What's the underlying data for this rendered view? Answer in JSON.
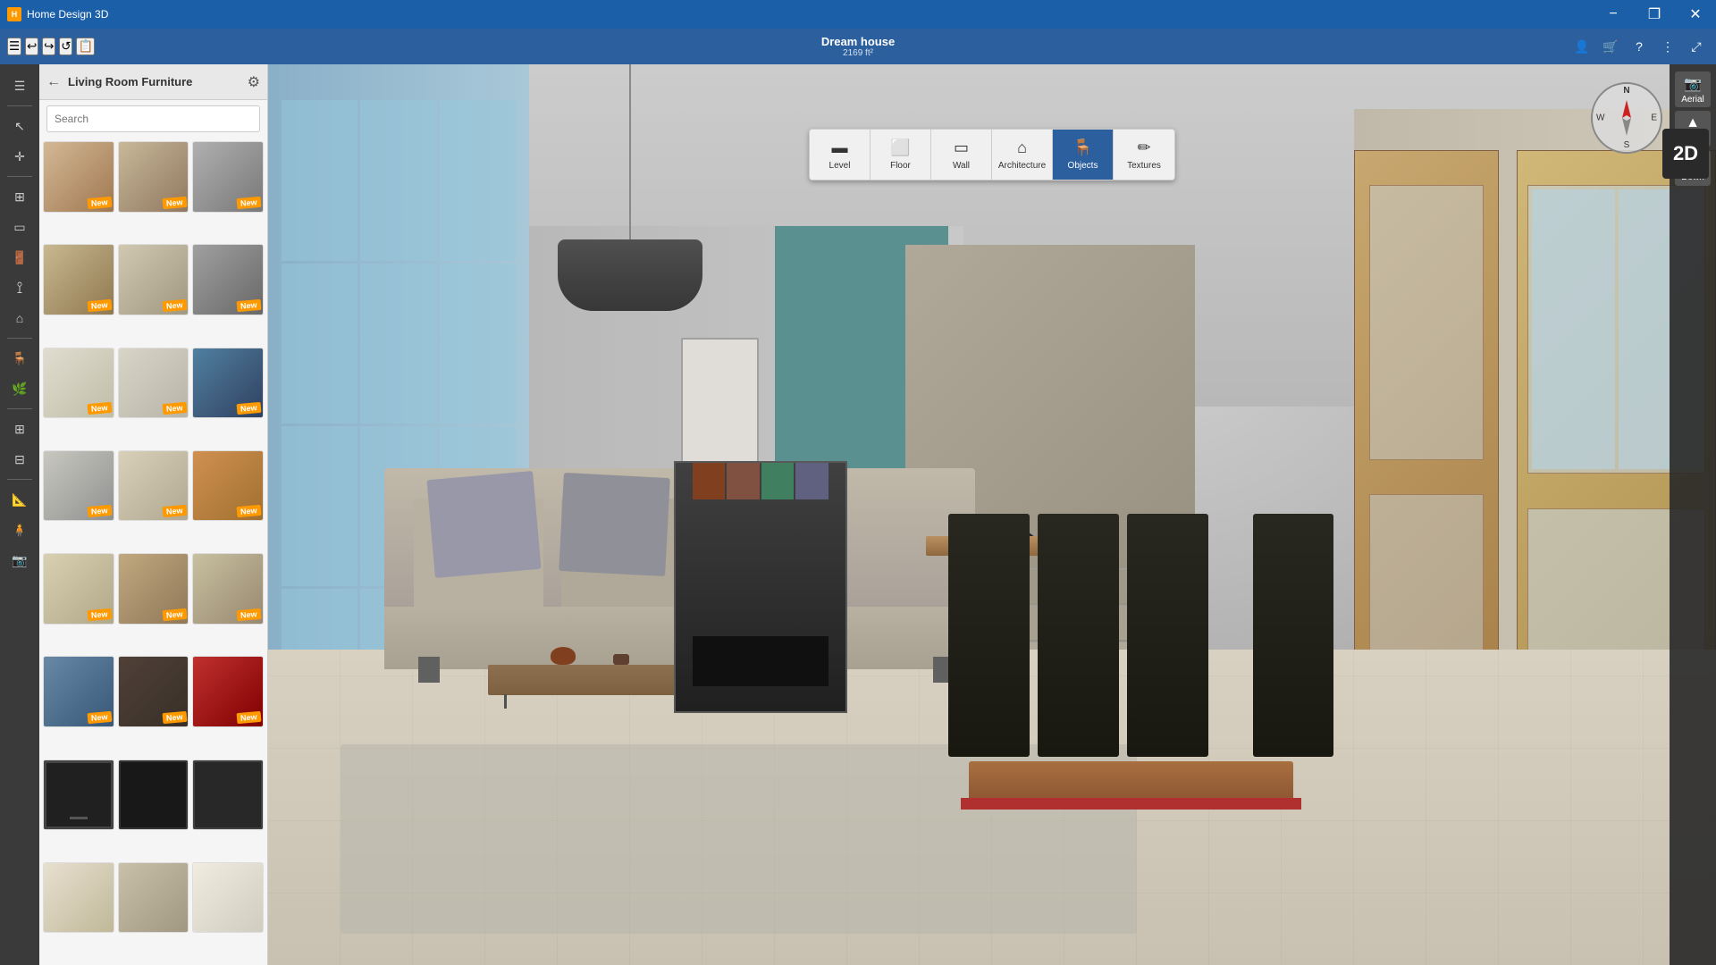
{
  "titlebar": {
    "app_name": "Home Design 3D",
    "minimize": "−",
    "restore": "❐",
    "close": "✕"
  },
  "toolbar": {
    "project_name": "Dream house",
    "project_size": "2169 ft²",
    "undo_label": "Undo",
    "redo_label": "Redo",
    "menu_label": "Menu"
  },
  "view_tabs": [
    {
      "id": "level",
      "label": "Level",
      "icon": "▬"
    },
    {
      "id": "floor",
      "label": "Floor",
      "icon": "⬜"
    },
    {
      "id": "wall",
      "label": "Wall",
      "icon": "▭"
    },
    {
      "id": "architecture",
      "label": "Architecture",
      "icon": "⌂"
    },
    {
      "id": "objects",
      "label": "Objects",
      "icon": "🪑"
    },
    {
      "id": "textures",
      "label": "Textures",
      "icon": "✏"
    }
  ],
  "active_tab": "objects",
  "view_mode": "2D",
  "panel": {
    "title": "Living Room Furniture",
    "search_placeholder": "Search",
    "back_button": "←",
    "settings_icon": "⚙"
  },
  "compass": {
    "n": "N",
    "s": "S",
    "e": "E",
    "w": "W"
  },
  "right_controls": [
    {
      "id": "aerial",
      "label": "Aerial",
      "icon": "📷"
    },
    {
      "id": "up",
      "label": "Up",
      "icon": "▲"
    },
    {
      "id": "down",
      "label": "Down",
      "icon": "▼"
    }
  ],
  "left_tools": [
    {
      "id": "menu",
      "icon": "☰"
    },
    {
      "id": "pointer",
      "icon": "↖"
    },
    {
      "id": "move",
      "icon": "✛"
    },
    {
      "id": "rooms",
      "icon": "⊞"
    },
    {
      "id": "walls",
      "icon": "▭"
    },
    {
      "id": "doors",
      "icon": "🚪"
    },
    {
      "id": "stairs",
      "icon": "⋮"
    },
    {
      "id": "roof",
      "icon": "⌂"
    },
    {
      "id": "chairs",
      "icon": "🪑"
    },
    {
      "id": "plants",
      "icon": "🌿"
    },
    {
      "id": "fence",
      "icon": "⩩"
    },
    {
      "id": "grid",
      "icon": "⊞"
    },
    {
      "id": "measure",
      "icon": "📐"
    },
    {
      "id": "figure",
      "icon": "🧍"
    },
    {
      "id": "camera",
      "icon": "📷"
    }
  ],
  "furniture_items": [
    {
      "id": 1,
      "theme": "thumb-1",
      "new": true
    },
    {
      "id": 2,
      "theme": "thumb-2",
      "new": true
    },
    {
      "id": 3,
      "theme": "thumb-3",
      "new": true
    },
    {
      "id": 4,
      "theme": "thumb-4",
      "new": true
    },
    {
      "id": 5,
      "theme": "thumb-5",
      "new": true
    },
    {
      "id": 6,
      "theme": "thumb-6",
      "new": true
    },
    {
      "id": 7,
      "theme": "thumb-7",
      "new": true
    },
    {
      "id": 8,
      "theme": "thumb-8",
      "new": true
    },
    {
      "id": 9,
      "theme": "thumb-9",
      "new": true
    },
    {
      "id": 10,
      "theme": "thumb-10",
      "new": true
    },
    {
      "id": 11,
      "theme": "thumb-11",
      "new": true
    },
    {
      "id": 12,
      "theme": "thumb-12",
      "new": true
    },
    {
      "id": 13,
      "theme": "thumb-7",
      "new": true
    },
    {
      "id": 14,
      "theme": "thumb-2",
      "new": true
    },
    {
      "id": 15,
      "theme": "thumb-4",
      "new": true
    },
    {
      "id": 16,
      "theme": "thumb-1",
      "new": true
    },
    {
      "id": 17,
      "theme": "thumb-11",
      "new": true
    },
    {
      "id": 18,
      "theme": "thumb-3",
      "new": true
    },
    {
      "id": 19,
      "theme": "tv1",
      "new": false
    },
    {
      "id": 20,
      "theme": "tv2",
      "new": false
    },
    {
      "id": 21,
      "theme": "tv3",
      "new": false
    },
    {
      "id": 22,
      "theme": "thumb-5",
      "new": false
    },
    {
      "id": 23,
      "theme": "thumb-6",
      "new": false
    },
    {
      "id": 24,
      "theme": "thumb-9",
      "new": false
    }
  ],
  "new_badge_label": "New",
  "colors": {
    "accent": "#2c5f9e",
    "toolbar_bg": "#2c5f9e",
    "badge_orange": "#f90000",
    "panel_bg": "#f5f5f5"
  }
}
